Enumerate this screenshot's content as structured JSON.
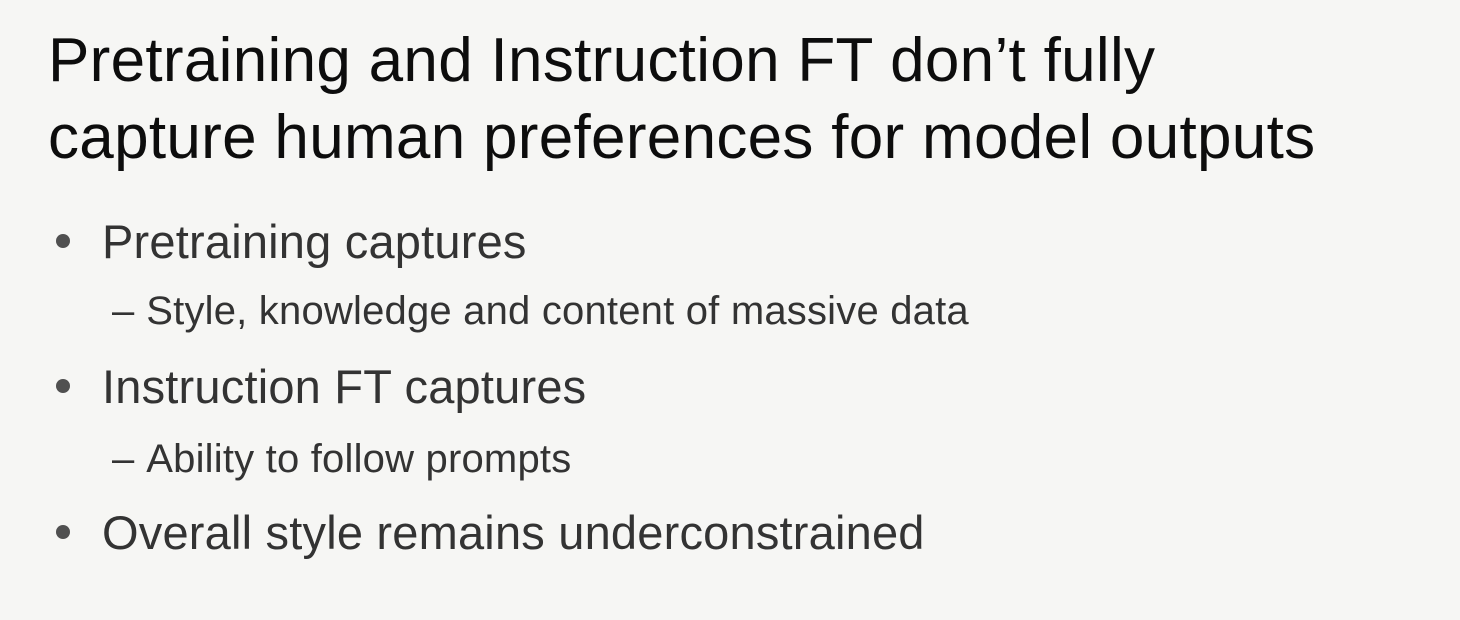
{
  "slide": {
    "title_line1": "Pretraining and Instruction FT don’t fully",
    "title_line2": "capture human preferences for model outputs",
    "bullets": [
      {
        "text": "Pretraining captures",
        "sub": [
          "Style, knowledge and content of massive data"
        ]
      },
      {
        "text": "Instruction FT captures",
        "sub": [
          "Ability to follow prompts"
        ]
      },
      {
        "text": "Overall style remains underconstrained",
        "sub": []
      }
    ],
    "sub_marker": "–"
  }
}
